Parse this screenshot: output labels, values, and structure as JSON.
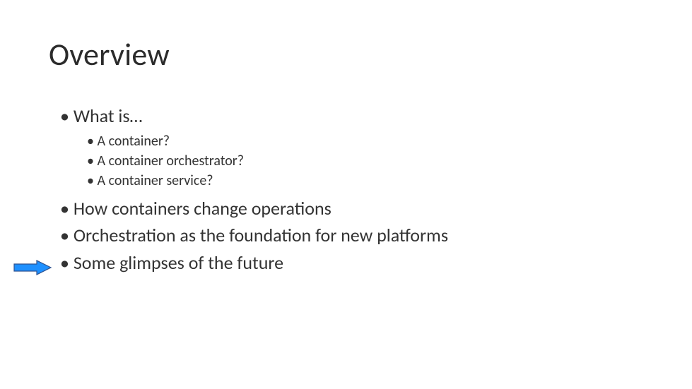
{
  "slide": {
    "title": "Overview",
    "l1_1": "What is…",
    "l2_1": "A container?",
    "l2_2": "A container orchestrator?",
    "l2_3": "A container service?",
    "l1_2": "How containers change operations",
    "l1_3": "Orchestration as the foundation for new platforms",
    "l1_4": "Some glimpses of the future"
  },
  "arrow": {
    "fill": "#1E90FF",
    "stroke": "#2F528F"
  }
}
